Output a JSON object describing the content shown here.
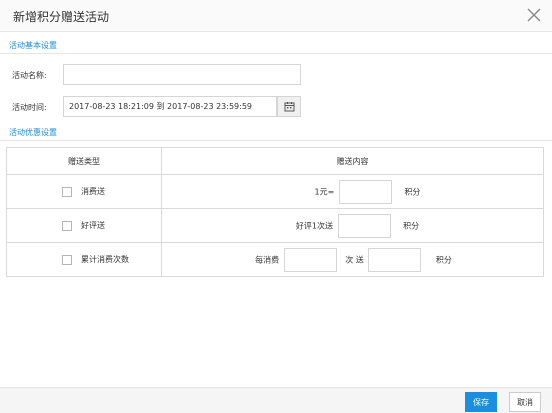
{
  "dialog": {
    "title": "新增积分赠送活动"
  },
  "basic": {
    "section_title": "活动基本设置",
    "name_label": "活动名称:",
    "name_value": "",
    "time_label": "活动时间:",
    "time_value": "2017-08-23 18:21:09 到 2017-08-23 23:59:59"
  },
  "promo": {
    "section_title": "活动优惠设置",
    "columns": [
      "赠送类型",
      "赠送内容"
    ],
    "rows": [
      {
        "type": "消费送",
        "checked": false,
        "prefix": "1元=",
        "suffix": "积分"
      },
      {
        "type": "好评送",
        "checked": false,
        "prefix": "好评1次送",
        "suffix": "积分"
      },
      {
        "type": "累计消费次数",
        "checked": false,
        "prefix": "每消费",
        "middle": "次 送",
        "suffix": "积分"
      }
    ]
  },
  "footer": {
    "save_label": "保存",
    "cancel_label": "取消"
  },
  "colors": {
    "accent": "#1a8fe0",
    "border": "#d5d5d5"
  }
}
